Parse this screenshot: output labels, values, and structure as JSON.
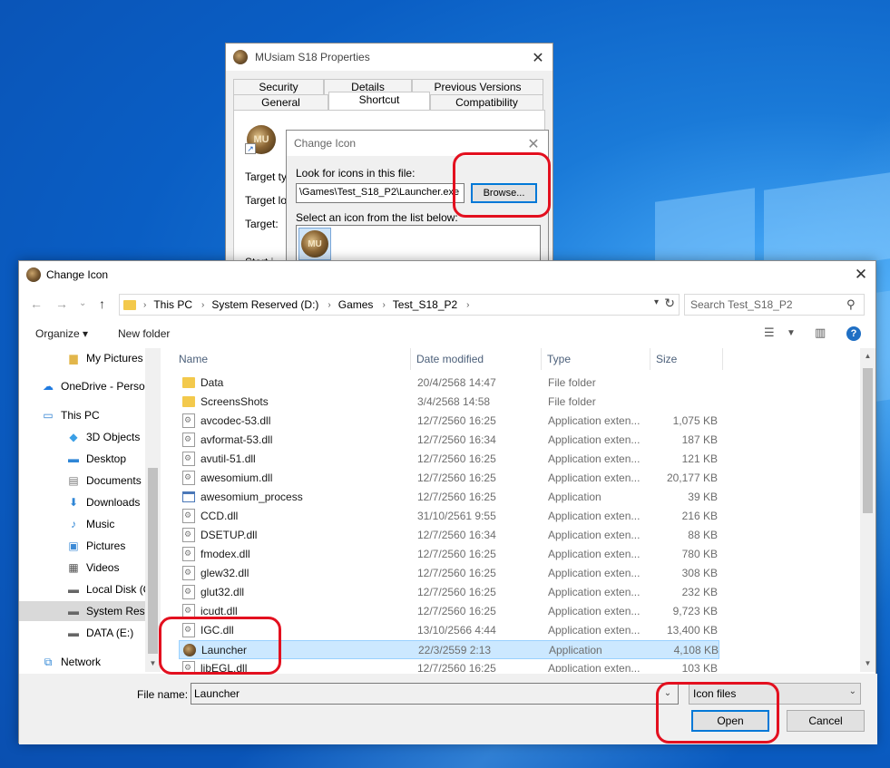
{
  "properties_window": {
    "title": "MUsiam S18 Properties",
    "tabs_row1": [
      "Security",
      "Details",
      "Previous Versions"
    ],
    "tabs_row2": [
      "General",
      "Shortcut",
      "Compatibility"
    ],
    "active_tab": "Shortcut",
    "icon_text": "MU",
    "labels": [
      "Target typ",
      "Target loc",
      "Target:",
      "Start i"
    ]
  },
  "change_icon_small": {
    "title": "Change Icon",
    "look_label": "Look for icons in this file:",
    "path_value": "\\Games\\Test_S18_P2\\Launcher.exe",
    "browse_label": "Browse...",
    "select_label": "Select an icon from the list below:",
    "icon_text": "MU"
  },
  "file_dialog": {
    "title": "Change Icon",
    "breadcrumb": [
      "This PC",
      "System Reserved (D:)",
      "Games",
      "Test_S18_P2"
    ],
    "search_placeholder": "Search Test_S18_P2",
    "toolbar": {
      "organize": "Organize ▾",
      "new_folder": "New folder",
      "help": "?"
    },
    "nav_items": [
      {
        "label": "My Pictures",
        "icon": "folder-pictures-icon",
        "glyph": "▆",
        "color": "#e2b64b",
        "indent": 52
      },
      {
        "label": "OneDrive - Person",
        "icon": "cloud-icon",
        "glyph": "☁",
        "color": "#1f7ae0",
        "indent": 24
      },
      {
        "label": "This PC",
        "icon": "computer-icon",
        "glyph": "▭",
        "color": "#2c7fd1",
        "indent": 24
      },
      {
        "label": "3D Objects",
        "icon": "cube-icon",
        "glyph": "◆",
        "color": "#3b9fe6",
        "indent": 52
      },
      {
        "label": "Desktop",
        "icon": "desktop-icon",
        "glyph": "▬",
        "color": "#2f86d6",
        "indent": 52
      },
      {
        "label": "Documents",
        "icon": "documents-icon",
        "glyph": "▤",
        "color": "#7a7a7a",
        "indent": 52
      },
      {
        "label": "Downloads",
        "icon": "download-icon",
        "glyph": "⬇",
        "color": "#2f86d6",
        "indent": 52
      },
      {
        "label": "Music",
        "icon": "music-icon",
        "glyph": "♪",
        "color": "#2f86d6",
        "indent": 52
      },
      {
        "label": "Pictures",
        "icon": "pictures-icon",
        "glyph": "▣",
        "color": "#3c8ad6",
        "indent": 52
      },
      {
        "label": "Videos",
        "icon": "videos-icon",
        "glyph": "▦",
        "color": "#555555",
        "indent": 52
      },
      {
        "label": "Local Disk (C:)",
        "icon": "drive-icon",
        "glyph": "▬",
        "color": "#666666",
        "indent": 52
      },
      {
        "label": "System Reserved",
        "icon": "drive-icon",
        "glyph": "▬",
        "color": "#666666",
        "indent": 52
      },
      {
        "label": "DATA (E:)",
        "icon": "drive-icon",
        "glyph": "▬",
        "color": "#666666",
        "indent": 52
      },
      {
        "label": "Network",
        "icon": "network-icon",
        "glyph": "⧉",
        "color": "#2f86d6",
        "indent": 24
      }
    ],
    "selected_nav": "System Reserved",
    "columns": [
      "Name",
      "Date modified",
      "Type",
      "Size"
    ],
    "files": [
      {
        "name": "Data",
        "date": "20/4/2568 14:47",
        "type": "File folder",
        "size": "",
        "kind": "folder"
      },
      {
        "name": "ScreensShots",
        "date": "3/4/2568 14:58",
        "type": "File folder",
        "size": "",
        "kind": "folder"
      },
      {
        "name": "avcodec-53.dll",
        "date": "12/7/2560 16:25",
        "type": "Application exten...",
        "size": "1,075 KB",
        "kind": "dll"
      },
      {
        "name": "avformat-53.dll",
        "date": "12/7/2560 16:34",
        "type": "Application exten...",
        "size": "187 KB",
        "kind": "dll"
      },
      {
        "name": "avutil-51.dll",
        "date": "12/7/2560 16:25",
        "type": "Application exten...",
        "size": "121 KB",
        "kind": "dll"
      },
      {
        "name": "awesomium.dll",
        "date": "12/7/2560 16:25",
        "type": "Application exten...",
        "size": "20,177 KB",
        "kind": "dll"
      },
      {
        "name": "awesomium_process",
        "date": "12/7/2560 16:25",
        "type": "Application",
        "size": "39 KB",
        "kind": "app"
      },
      {
        "name": "CCD.dll",
        "date": "31/10/2561 9:55",
        "type": "Application exten...",
        "size": "216 KB",
        "kind": "dll"
      },
      {
        "name": "DSETUP.dll",
        "date": "12/7/2560 16:34",
        "type": "Application exten...",
        "size": "88 KB",
        "kind": "dll"
      },
      {
        "name": "fmodex.dll",
        "date": "12/7/2560 16:25",
        "type": "Application exten...",
        "size": "780 KB",
        "kind": "dll"
      },
      {
        "name": "glew32.dll",
        "date": "12/7/2560 16:25",
        "type": "Application exten...",
        "size": "308 KB",
        "kind": "dll"
      },
      {
        "name": "glut32.dll",
        "date": "12/7/2560 16:25",
        "type": "Application exten...",
        "size": "232 KB",
        "kind": "dll"
      },
      {
        "name": "icudt.dll",
        "date": "12/7/2560 16:25",
        "type": "Application exten...",
        "size": "9,723 KB",
        "kind": "dll"
      },
      {
        "name": "IGC.dll",
        "date": "13/10/2566 4:44",
        "type": "Application exten...",
        "size": "13,400 KB",
        "kind": "dll"
      },
      {
        "name": "Launcher",
        "date": "22/3/2559 2:13",
        "type": "Application",
        "size": "4,108 KB",
        "kind": "launcher"
      },
      {
        "name": "libEGL.dll",
        "date": "12/7/2560 16:25",
        "type": "Application exten...",
        "size": "103 KB",
        "kind": "dll"
      }
    ],
    "selected_file": "Launcher",
    "file_name_label": "File name:",
    "file_name_value": "Launcher",
    "file_type": "Icon files",
    "open_label": "Open",
    "cancel_label": "Cancel"
  },
  "colors": {
    "selection": "#cce8ff",
    "annotation": "#e3101f",
    "accent": "#0078d7"
  }
}
